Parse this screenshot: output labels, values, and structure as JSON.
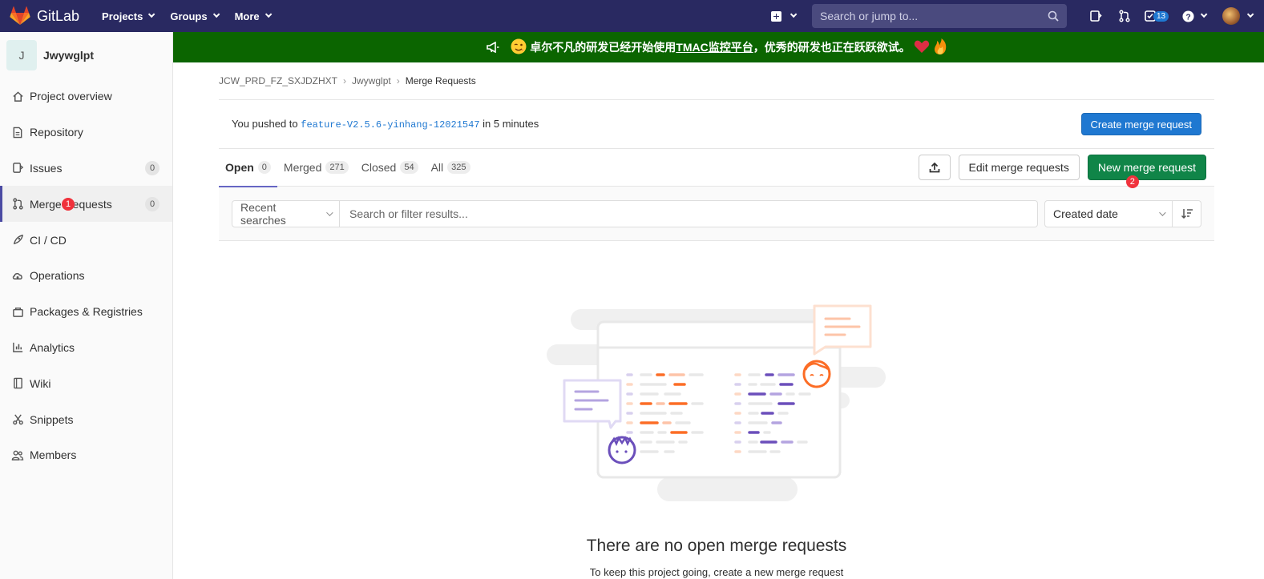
{
  "nav": {
    "brand": "GitLab",
    "menu": [
      {
        "label": "Projects"
      },
      {
        "label": "Groups"
      },
      {
        "label": "More"
      }
    ],
    "search_placeholder": "Search or jump to...",
    "todo_count": "13",
    "colors": {
      "navbar": "#292961",
      "logo": "#e24329"
    }
  },
  "sidebar": {
    "project_initial": "J",
    "project_name": "Jwywglpt",
    "items": [
      {
        "label": "Project overview",
        "icon": "home-icon"
      },
      {
        "label": "Repository",
        "icon": "document-icon"
      },
      {
        "label": "Issues",
        "icon": "issues-icon",
        "count": "0"
      },
      {
        "label": "Merge Requests",
        "icon": "merge-request-icon",
        "count": "0",
        "active": true
      },
      {
        "label": "CI / CD",
        "icon": "rocket-icon"
      },
      {
        "label": "Operations",
        "icon": "cloud-gear-icon"
      },
      {
        "label": "Packages & Registries",
        "icon": "package-icon"
      },
      {
        "label": "Analytics",
        "icon": "chart-icon"
      },
      {
        "label": "Wiki",
        "icon": "book-icon"
      },
      {
        "label": "Snippets",
        "icon": "scissors-icon"
      },
      {
        "label": "Members",
        "icon": "users-icon"
      }
    ]
  },
  "markers": {
    "first": "1",
    "second": "2"
  },
  "banner": {
    "text_before": "卓尔不凡的研发已经开始使用",
    "link": "TMAC监控平台",
    "text_after": "，优秀的研发也正在跃跃欲试。",
    "background": "#0b6500"
  },
  "breadcrumb": {
    "group": "JCW_PRD_FZ_SXJDZHXT",
    "project": "Jwywglpt",
    "current": "Merge Requests"
  },
  "push_alert": {
    "prefix": "You pushed to",
    "branch": "feature-V2.5.6-yinhang-12021547",
    "suffix": "in 5 minutes",
    "button": "Create merge request"
  },
  "tabs": [
    {
      "label": "Open",
      "count": "0",
      "active": true
    },
    {
      "label": "Merged",
      "count": "271"
    },
    {
      "label": "Closed",
      "count": "54"
    },
    {
      "label": "All",
      "count": "325"
    }
  ],
  "actions": {
    "edit": "Edit merge requests",
    "new": "New merge request"
  },
  "filter": {
    "recent": "Recent searches",
    "placeholder": "Search or filter results...",
    "sort": "Created date"
  },
  "empty_state": {
    "title": "There are no open merge requests",
    "subtitle": "To keep this project going, create a new merge request"
  }
}
